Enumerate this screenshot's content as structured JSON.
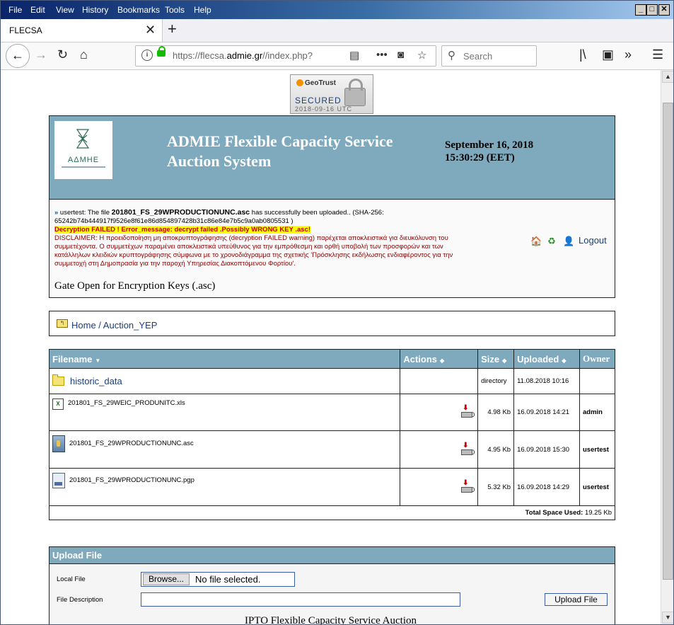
{
  "menu": {
    "file": "File",
    "edit": "Edit",
    "view": "View",
    "history": "History",
    "bookmarks": "Bookmarks",
    "tools": "Tools",
    "help": "Help"
  },
  "tab": {
    "title": "FLECSA"
  },
  "url": {
    "prefix": "https://flecsa.",
    "domain": "admie.gr",
    "suffix": "//index.php?"
  },
  "search": {
    "placeholder": "Search"
  },
  "seal": {
    "brand": "GeoTrust",
    "secured": "SECURED",
    "date": "2018-09-16 UTC"
  },
  "header": {
    "logo_text": "ΑΔΜΗΕ",
    "title_line1": "ADMIE Flexible Capacity Service",
    "title_line2": "Auction System",
    "date": "September 16, 2018",
    "time": "15:30:29 (EET)"
  },
  "messages": {
    "marker": "»",
    "upload_prefix": " usertest: The file ",
    "filename": "201801_FS_29WPRODUCTIONUNC.asc",
    "upload_suffix": " has successfully been uploaded.. (SHA-256: 65242b74b444917f9526e8f61e86d854897428b31c86e84e7b5c9a0ab0805531 )",
    "fail": "Decryption FAILED ! Error_message: decrypt failed .Possibly WRONG KEY .asc!",
    "disclaimer": "DISCLAIMER: Η προειδοποίηση μη αποκρυπτογράφησης (decryption FAILED warning) παρέχεται αποκλειστικά για διευκόλυνση του συμμετέχοντα. Ο συμμετέχων παραμένει αποκλειστικά υπεύθυνος για την εμπρόθεσμη και ορθή υποβολή των προσφορών και των κατάλληλων κλειδιών κρυπτογράφησης σύμφωνα με το χρονοδιάγραμμα της σχετικής 'Πρόσκλησης εκδήλωσης ενδιαφέροντος για την συμμετοχή στη Δημοπρασία για την παροχή Υπηρεσίας Διακοπτόμενου Φορτίου'.",
    "gate": "Gate Open for Encryption Keys (.asc)"
  },
  "nav": {
    "logout": "Logout"
  },
  "breadcrumb": {
    "text": "Home / Auction_YEP"
  },
  "table": {
    "headers": {
      "filename": "Filename",
      "actions": "Actions",
      "size": "Size",
      "uploaded": "Uploaded",
      "owner": "Owner"
    },
    "rows": [
      {
        "name": "historic_data",
        "size": "directory",
        "uploaded": "11.08.2018 10:16",
        "owner": "",
        "dl": ""
      },
      {
        "name": "201801_FS_29WEIC_PRODUNITC.xls",
        "size": "4.98 Kb",
        "uploaded": "16.09.2018 14:21",
        "owner": "admin",
        "dl": "0"
      },
      {
        "name": "201801_FS_29WPRODUCTIONUNC.asc",
        "size": "4.95 Kb",
        "uploaded": "16.09.2018 15:30",
        "owner": "usertest",
        "dl": "0"
      },
      {
        "name": "201801_FS_29WPRODUCTIONUNC.pgp",
        "size": "5.32 Kb",
        "uploaded": "16.09.2018 14:29",
        "owner": "usertest",
        "dl": "0"
      }
    ],
    "total_label": "Total Space Used:",
    "total_value": " 19.25 Kb"
  },
  "upload": {
    "title": "Upload File",
    "local_file": "Local File",
    "browse": "Browse...",
    "no_file": "No file selected.",
    "description": "File Description",
    "button": "Upload File"
  },
  "footer": {
    "text": "IPTO Flexible Capacity Service Auction"
  },
  "colors": {
    "header_bg": "#7fa9bd",
    "link": "#1a3f7a",
    "fail_bg": "#ffff00",
    "fail_text": "#c00000"
  }
}
